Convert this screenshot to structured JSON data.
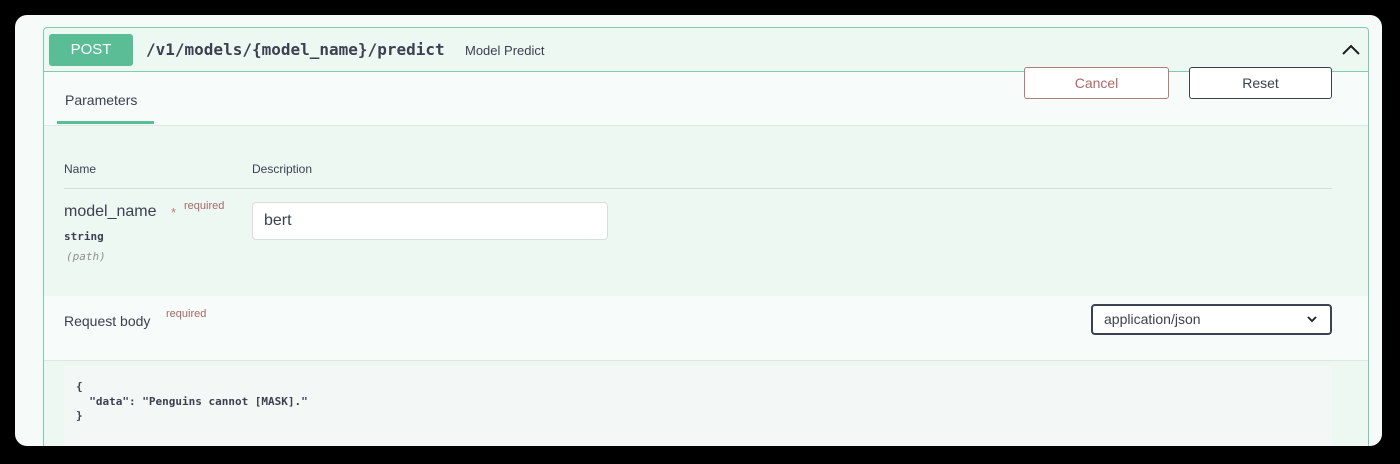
{
  "operation": {
    "method": "POST",
    "path": "/v1/models/{model_name}/predict",
    "summary": "Model Predict"
  },
  "tabs": {
    "parameters": "Parameters"
  },
  "buttons": {
    "cancel": "Cancel",
    "reset": "Reset"
  },
  "params_table": {
    "col_name": "Name",
    "col_description": "Description"
  },
  "parameter": {
    "name": "model_name",
    "required_star": "*",
    "required_label": "required",
    "type": "string",
    "location": "(path)",
    "value": "bert"
  },
  "request_body": {
    "label": "Request body",
    "required_label": "required",
    "content_type": "application/json",
    "code": "{\n  \"data\": \"Penguins cannot [MASK].\"\n}"
  },
  "colors": {
    "post_accent": "#5bbd96",
    "border": "#7fcdb0",
    "cancel": "#b57b7a"
  }
}
